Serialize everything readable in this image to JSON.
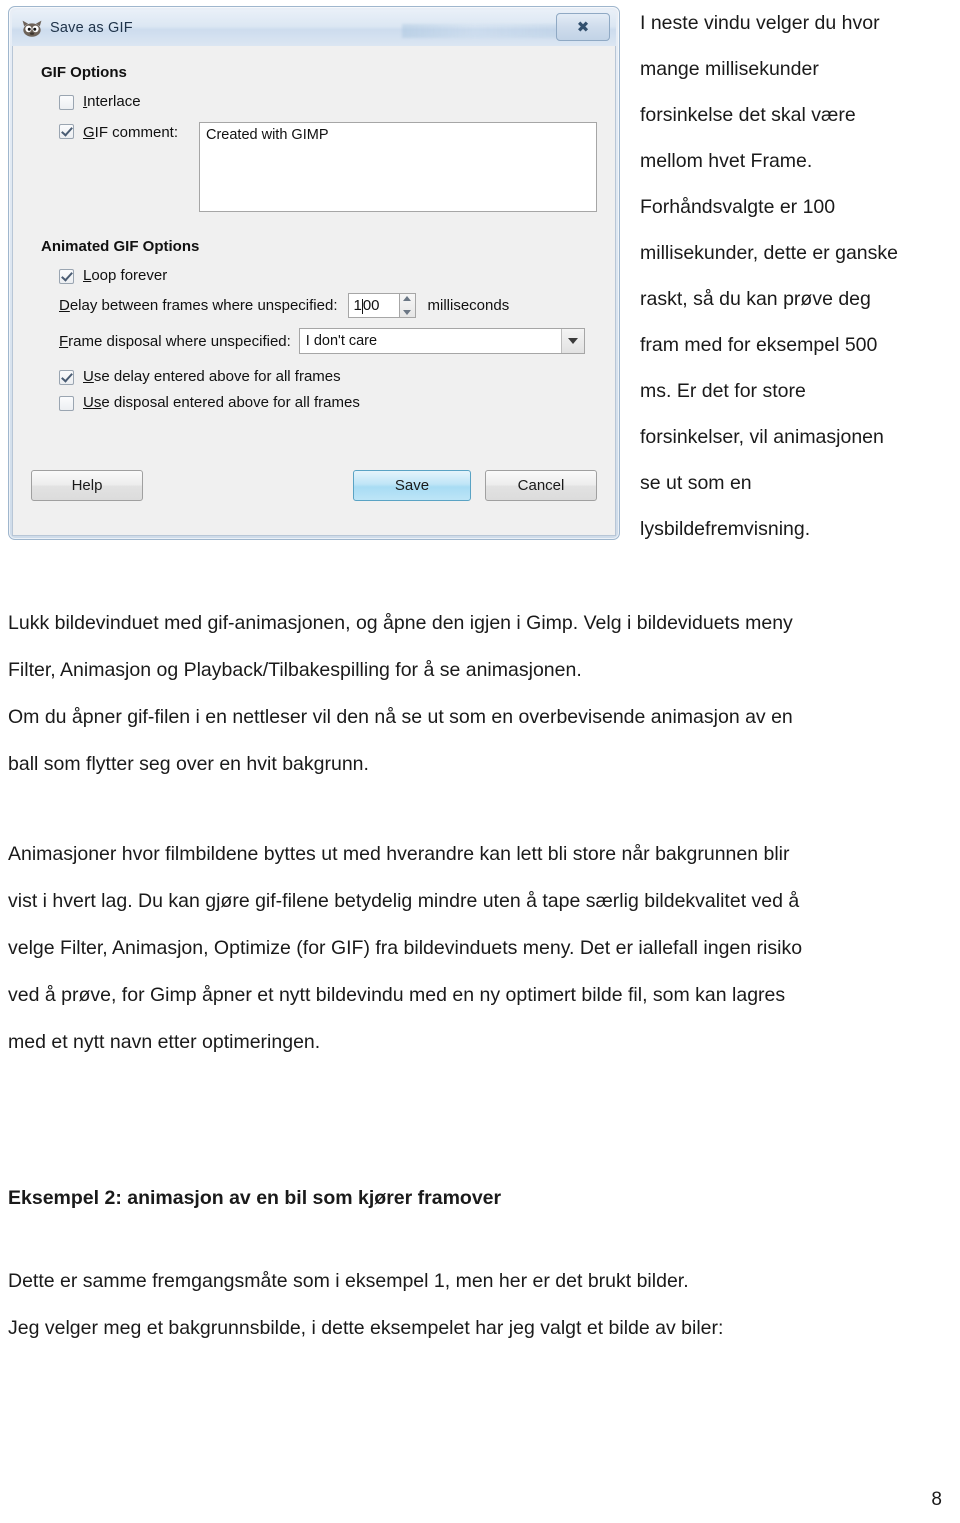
{
  "dialog": {
    "title": "Save as GIF",
    "icon": "gimp-wilber-icon",
    "close_label": "✖",
    "groups": {
      "gif_options": {
        "title": "GIF Options",
        "interlace": {
          "label": "Interlace",
          "label_mnemonic": "I",
          "label_rest": "nterlace",
          "checked": false
        },
        "gif_comment": {
          "label": "GIF comment:",
          "label_mnemonic": "G",
          "label_rest": "IF comment:",
          "checked": true,
          "value": "Created with GIMP"
        }
      },
      "animated_gif_options": {
        "title": "Animated GIF Options",
        "loop_forever": {
          "label": "Loop forever",
          "label_mnemonic": "L",
          "label_rest": "oop forever",
          "checked": true
        },
        "delay": {
          "label": "Delay between frames where unspecified:",
          "label_mnemonic": "D",
          "label_rest": "elay between frames where unspecified:",
          "value_before_caret": "1",
          "value_after_caret": "00",
          "value": "100",
          "unit": "milliseconds"
        },
        "frame_disposal": {
          "label": "Frame disposal where unspecified:",
          "label_mnemonic": "F",
          "label_rest": "rame disposal where unspecified:",
          "selected": "I don't care"
        },
        "use_delay_all": {
          "label": "Use delay entered above for all frames",
          "label_mnemonic": "U",
          "label_rest": "se delay entered above for all frames",
          "checked": true
        },
        "use_disposal_all": {
          "label": "Use disposal entered above for all frames",
          "label_mnemonic": "Us",
          "label_rest": "e disposal entered above for all frames",
          "checked": false
        }
      }
    },
    "buttons": {
      "help": "Help",
      "save": "Save",
      "cancel": "Cancel"
    }
  },
  "side_text": {
    "lines": [
      "I neste vindu velger du hvor",
      "mange millisekunder",
      "forsinkelse det skal være",
      "mellom hvet Frame.",
      "Forhåndsvalgte er 100",
      "millisekunder, dette er ganske",
      "raskt, så du kan prøve deg",
      "fram med for eksempel 500",
      "ms. Er det for store",
      "forsinkelser, vil animasjonen",
      "se ut som en",
      "lysbildefremvisning."
    ]
  },
  "body": {
    "paragraph1": [
      "Lukk bildevinduet med gif-animasjonen, og åpne den igjen i Gimp. Velg i bildeviduets meny",
      "Filter, Animasjon og Playback/Tilbakespilling for å se animasjonen."
    ],
    "paragraph2": [
      "Om du åpner gif-filen i en nettleser vil den nå se ut som en overbevisende animasjon av en",
      "ball som flytter seg over en hvit bakgrunn."
    ],
    "paragraph3": [
      "Animasjoner hvor filmbildene byttes ut med hverandre kan lett bli store når bakgrunnen blir",
      "vist i hvert lag. Du kan gjøre gif-filene betydelig mindre uten å tape særlig bildekvalitet ved å",
      "velge Filter, Animasjon, Optimize (for GIF) fra bildevinduets meny. Det er iallefall ingen risiko",
      "ved å prøve, for Gimp åpner et nytt bildevindu med en ny optimert bilde fil, som kan lagres",
      "med et nytt navn etter optimeringen."
    ],
    "heading2": "Eksempel 2: animasjon av en bil som kjører framover",
    "paragraph4": "Dette er samme fremgangsmåte som i eksempel 1, men her er det brukt bilder.",
    "paragraph5": "Jeg velger meg et bakgrunnsbilde, i dette eksempelet har jeg valgt et bilde av biler:"
  },
  "footer": {
    "page_number": "8"
  }
}
